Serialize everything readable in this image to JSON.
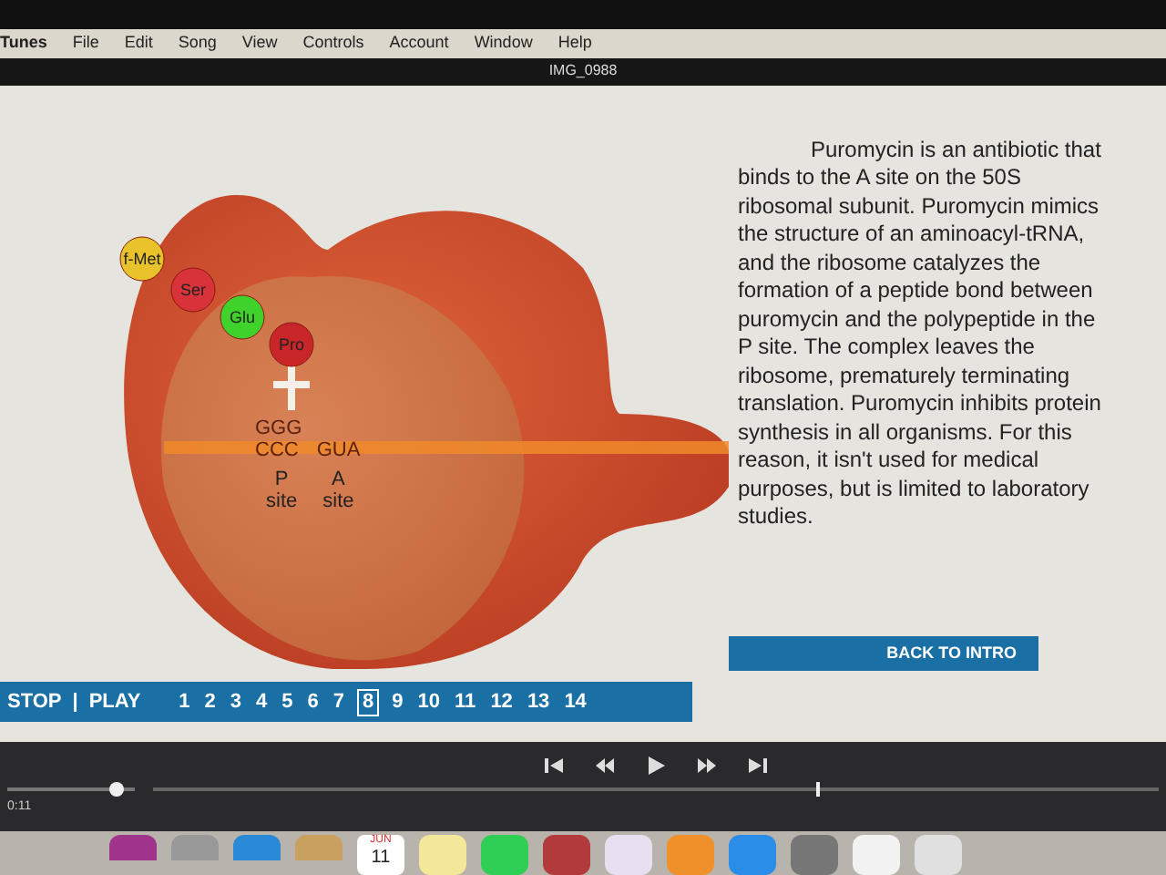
{
  "menu_bar": {
    "app": "Tunes",
    "items": [
      "File",
      "Edit",
      "Song",
      "View",
      "Controls",
      "Account",
      "Window",
      "Help"
    ]
  },
  "window": {
    "title": "IMG_0988"
  },
  "diagram": {
    "amino_acids": [
      {
        "label": "f-Met",
        "color": "#e8c22a"
      },
      {
        "label": "Ser",
        "color": "#d8323a"
      },
      {
        "label": "Glu",
        "color": "#3fd22a"
      },
      {
        "label": "Pro",
        "color": "#c9262a"
      }
    ],
    "anticodon": "GGG",
    "codons": [
      "CCC",
      "GUA"
    ],
    "sites": [
      {
        "letter": "P",
        "word": "site"
      },
      {
        "letter": "A",
        "word": "site"
      }
    ]
  },
  "paragraph": {
    "lead": "Puromycin is an",
    "body": "antibiotic that binds to the A site on the 50S ribosomal subunit. Puromycin mimics the structure of an aminoacyl-tRNA, and the ribosome catalyzes the formation of a peptide bond between puromycin and the polypeptide in the P site. The complex leaves the ribosome, prematurely terminating translation. Puromycin inhibits protein synthesis in all organisms. For this reason, it isn't used for medical purposes, but is limited to laboratory studies."
  },
  "nav": {
    "stop": "STOP",
    "separator": "|",
    "play": "PLAY",
    "back": "BACK TO INTRO",
    "pages": [
      {
        "label": "1",
        "selected": false
      },
      {
        "label": "2",
        "selected": false
      },
      {
        "label": "3",
        "selected": false
      },
      {
        "label": "4",
        "selected": false
      },
      {
        "label": "5",
        "selected": false
      },
      {
        "label": "6",
        "selected": false
      },
      {
        "label": "7",
        "selected": false
      },
      {
        "label": "8",
        "selected": true
      },
      {
        "label": "9",
        "selected": false
      },
      {
        "label": "10",
        "selected": false
      },
      {
        "label": "11",
        "selected": false
      },
      {
        "label": "12",
        "selected": false
      },
      {
        "label": "13",
        "selected": false
      },
      {
        "label": "14",
        "selected": false
      }
    ]
  },
  "player": {
    "time": "0:11",
    "volume": {
      "level": 0.85
    },
    "progress": {
      "level": 0.66
    }
  },
  "dock": {
    "calendar": {
      "month": "JUN",
      "day": "11"
    }
  }
}
